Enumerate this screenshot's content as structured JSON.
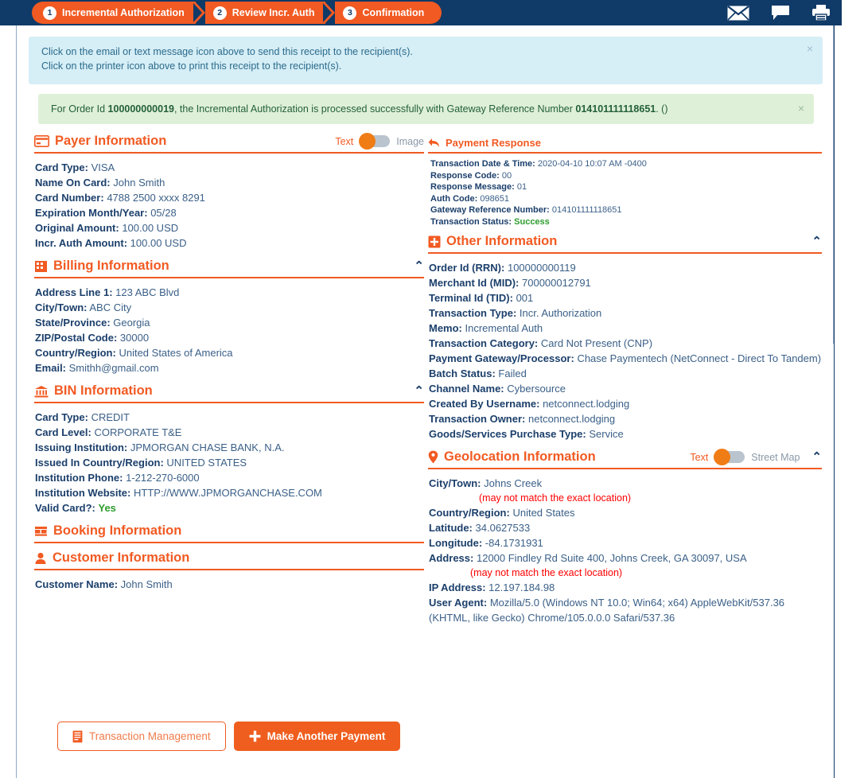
{
  "wizard": {
    "steps": [
      {
        "num": "1",
        "label": "Incremental Authorization"
      },
      {
        "num": "2",
        "label": "Review Incr. Auth"
      },
      {
        "num": "3",
        "label": "Confirmation"
      }
    ]
  },
  "header_icons": [
    {
      "name": "email-icon",
      "label": "Email"
    },
    {
      "name": "text-message-icon",
      "label": "Text Message"
    },
    {
      "name": "printer-icon",
      "label": "Print"
    }
  ],
  "alerts": {
    "info": {
      "line1": "Click on the email or text message icon above to send this receipt to the recipient(s).",
      "line2": "Click on the printer icon above to print this receipt to the recipient(s).",
      "close": "×"
    },
    "success": {
      "prefix": "For Order Id ",
      "order_id": "100000000019",
      "middle": ", the Incremental Authorization is processed successfully with Gateway Reference Number ",
      "gateway_ref": "014101111118651",
      "suffix": ". ()",
      "close": "×"
    }
  },
  "payer": {
    "title": "Payer Information",
    "toggle": {
      "left": "Text",
      "right": "Image",
      "position": "left"
    },
    "fields": [
      {
        "k": "Card Type:",
        "v": "VISA"
      },
      {
        "k": "Name On Card:",
        "v": "John Smith"
      },
      {
        "k": "Card Number:",
        "v": "4788 2500 xxxx 8291"
      },
      {
        "k": "Expiration Month/Year:",
        "v": "05/28"
      },
      {
        "k": "Original Amount:",
        "v": "100.00 USD"
      },
      {
        "k": "Incr. Auth Amount:",
        "v": "100.00 USD"
      }
    ]
  },
  "billing": {
    "title": "Billing Information",
    "caret": "⌃",
    "fields": [
      {
        "k": "Address Line 1:",
        "v": "123 ABC Blvd"
      },
      {
        "k": "City/Town:",
        "v": "ABC City"
      },
      {
        "k": "State/Province:",
        "v": "Georgia"
      },
      {
        "k": "ZIP/Postal Code:",
        "v": "30000"
      },
      {
        "k": "Country/Region:",
        "v": "United States of America"
      },
      {
        "k": "Email:",
        "v": "Smithh@gmail.com"
      }
    ]
  },
  "bin": {
    "title": "BIN Information",
    "caret": "⌃",
    "fields": [
      {
        "k": "Card Type:",
        "v": "CREDIT"
      },
      {
        "k": "Card Level:",
        "v": "CORPORATE T&E"
      },
      {
        "k": "Issuing Institution:",
        "v": "JPMORGAN CHASE BANK, N.A."
      },
      {
        "k": "Issued In Country/Region:",
        "v": "UNITED STATES"
      },
      {
        "k": "Institution Phone:",
        "v": "1-212-270-6000"
      },
      {
        "k": "Institution Website:",
        "v": "HTTP://WWW.JPMORGANCHASE.COM"
      },
      {
        "k": "Valid Card?:",
        "v": "Yes",
        "ok": true
      }
    ]
  },
  "booking": {
    "title": "Booking Information"
  },
  "customer": {
    "title": "Customer Information",
    "fields": [
      {
        "k": "Customer Name:",
        "v": "John Smith"
      }
    ]
  },
  "payment_response": {
    "title": "Payment Response",
    "fields": [
      {
        "k": "Transaction Date & Time:",
        "v": "2020-04-10 10:07 AM -0400"
      },
      {
        "k": "Response Code:",
        "v": "00"
      },
      {
        "k": "Response Message:",
        "v": "01"
      },
      {
        "k": "Auth Code:",
        "v": "098651"
      },
      {
        "k": "Gateway Reference Number:",
        "v": "014101111118651"
      },
      {
        "k": "Transaction Status:",
        "v": "Success",
        "ok": true
      }
    ]
  },
  "other": {
    "title": "Other Information",
    "caret": "⌃",
    "fields": [
      {
        "k": "Order Id (RRN):",
        "v": "100000000119"
      },
      {
        "k": "Merchant Id (MID):",
        "v": "700000012791"
      },
      {
        "k": "Terminal Id (TID):",
        "v": "001"
      },
      {
        "k": "Transaction Type:",
        "v": "Incr. Authorization"
      },
      {
        "k": "Memo:",
        "v": "Incremental Auth"
      },
      {
        "k": "Transaction Category:",
        "v": "Card Not Present (CNP)"
      },
      {
        "k": "Payment Gateway/Processor:",
        "v": "Chase Paymentech (NetConnect - Direct To Tandem)"
      },
      {
        "k": "Batch Status:",
        "v": "Failed"
      },
      {
        "k": "Channel Name:",
        "v": "Cybersource"
      },
      {
        "k": "Created By Username:",
        "v": "netconnect.lodging"
      },
      {
        "k": "Transaction Owner:",
        "v": "netconnect.lodging"
      },
      {
        "k": "Goods/Services Purchase Type:",
        "v": "Service"
      }
    ]
  },
  "geolocation": {
    "title": "Geolocation Information",
    "caret": "⌃",
    "toggle": {
      "left": "Text",
      "right": "Street Map",
      "position": "left"
    },
    "city_k": "City/Town:",
    "city_v": "Johns Creek",
    "note1": "(may not match the exact location)",
    "country_k": "Country/Region:",
    "country_v": "United States",
    "lat_k": "Latitude:",
    "lat_v": "34.0627533",
    "lon_k": "Longitude:",
    "lon_v": "-84.1731931",
    "addr_k": "Address:",
    "addr_v": "12000 Findley Rd Suite 400, Johns Creek, GA 30097, USA",
    "note2": "(may not match the exact location)",
    "ip_k": "IP Address:",
    "ip_v": "12.197.184.98",
    "ua_k": "User Agent:",
    "ua_v": "Mozilla/5.0 (Windows NT 10.0; Win64; x64) AppleWebKit/537.36 (KHTML, like Gecko) Chrome/105.0.0.0 Safari/537.36"
  },
  "buttons": {
    "transaction_management": "Transaction Management",
    "make_another_payment": "Make Another Payment"
  },
  "colors": {
    "navy": "#103a67",
    "orange": "#f15a22",
    "info_bg": "#d6eef6",
    "success_bg": "#dff0d8",
    "label": "#1b3f6b",
    "value": "#3b6088",
    "green": "#2e9c2e",
    "red": "#ff0000"
  }
}
